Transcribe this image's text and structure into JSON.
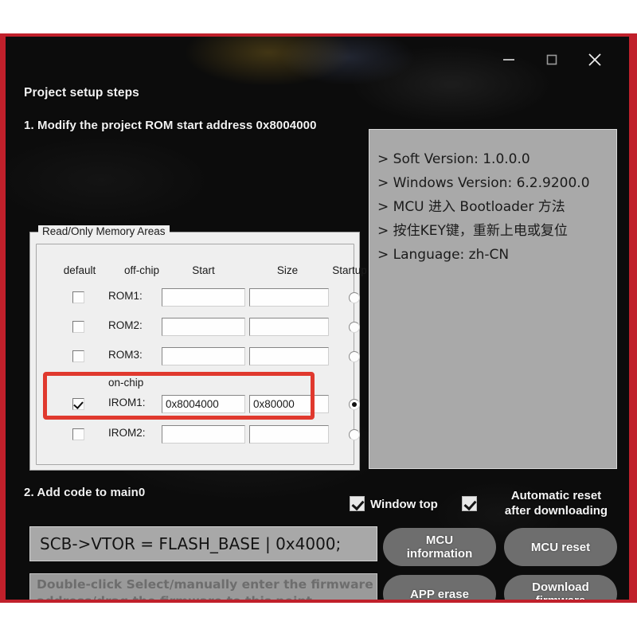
{
  "window": {
    "controls": {
      "minimize_label": "Minimize",
      "maximize_label": "Maximize",
      "close_label": "Close"
    },
    "accent_color": "#c0202b",
    "background_color": "#0d0d0d"
  },
  "left_panel": {
    "setup_title": "Project setup steps",
    "step1": "1. Modify the project ROM start address 0x8004000",
    "step2": "2. Add code to main0",
    "code_snippet": "SCB->VTOR = FLASH_BASE | 0x4000;",
    "drop_zone_placeholder": "Double-click Select/manually enter the firmware address/drag the firmware to this point"
  },
  "memory_group": {
    "legend": "Read/Only Memory Areas",
    "columns": {
      "default": "default",
      "offchip": "off-chip",
      "start": "Start",
      "size": "Size",
      "startup": "Startup"
    },
    "onchip_label": "on-chip",
    "highlight_color": "#e0392e",
    "rows": [
      {
        "label": "ROM1:",
        "checked": false,
        "start": "",
        "size": "",
        "startup": false
      },
      {
        "label": "ROM2:",
        "checked": false,
        "start": "",
        "size": "",
        "startup": false
      },
      {
        "label": "ROM3:",
        "checked": false,
        "start": "",
        "size": "",
        "startup": false
      },
      {
        "label": "IROM1:",
        "checked": true,
        "start": "0x8004000",
        "size": "0x80000",
        "startup": true
      },
      {
        "label": "IROM2:",
        "checked": false,
        "start": "",
        "size": "",
        "startup": false
      }
    ]
  },
  "info_panel": {
    "lines": [
      "> Soft Version: 1.0.0.0",
      "> Windows Version: 6.2.9200.0",
      "> MCU 进入 Bootloader 方法",
      "> 按住KEY键，重新上电或复位",
      "> Language: zh-CN"
    ]
  },
  "options": {
    "window_top": {
      "label": "Window top",
      "checked": true
    },
    "auto_reset": {
      "label": "Automatic reset after downloading",
      "line1": "Automatic reset",
      "line2": "after downloading",
      "checked": true
    }
  },
  "buttons": {
    "mcu_information": {
      "line1": "MCU",
      "line2": "information"
    },
    "mcu_reset": {
      "line1": "MCU reset",
      "line2": ""
    },
    "app_erase": {
      "line1": "APP erase",
      "line2": ""
    },
    "download_firmware": {
      "line1": "Download",
      "line2": "firmware"
    }
  }
}
